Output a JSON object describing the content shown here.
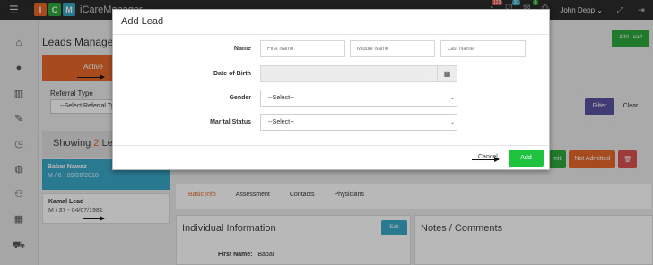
{
  "topbar": {
    "logo_letters": [
      "I",
      "C",
      "M"
    ],
    "logo_colors": [
      "#e8682a",
      "#2eaa3c",
      "#3aa8c8"
    ],
    "app_title": "iCareManager",
    "notif_counts": [
      "129",
      "37",
      "6"
    ],
    "user_name": "John Depp",
    "user_chevron": "⌄"
  },
  "page": {
    "title": "Leads Managem",
    "active_tab": "Active",
    "referral_label": "Referral Type",
    "referral_select": "--Select Referral Ty",
    "showing_text": "Showing",
    "showing_count": "2",
    "showing_suffix": "Lea",
    "add_lead_button": "Add Lead",
    "filter_button": "Filter",
    "clear_button": "Clear",
    "actions": [
      "mit",
      "Not Admitted"
    ],
    "patients": [
      {
        "name": "Babar Nawaz",
        "meta": "M / 6 - 09/26/2018"
      },
      {
        "name": "Kamal Lead",
        "meta": "M / 37 - 04/07/1981"
      }
    ],
    "detail_tabs": [
      "Basic Info",
      "Assessment",
      "Contacts",
      "Physicians"
    ],
    "individual_info_title": "Individual Information",
    "edit_button": "Edit",
    "first_name_label": "First Name:",
    "first_name_value": "Babar",
    "notes_title": "Notes / Comments"
  },
  "modal": {
    "title": "Add Lead",
    "name_label": "Name",
    "first_name_placeholder": "First Name",
    "middle_name_placeholder": "Middle Name",
    "last_name_placeholder": "Last Name",
    "dob_label": "Date of Birth",
    "gender_label": "Gender",
    "gender_value": "--Select--",
    "marital_label": "Marital Status",
    "marital_value": "--Select--",
    "cancel_label": "Cancel",
    "add_label": "Add"
  },
  "colors": {
    "accent_orange": "#e8682a",
    "green": "#2eaa3c",
    "teal": "#3aa8c8",
    "purple": "#5b52a0",
    "danger": "#d9534f"
  }
}
